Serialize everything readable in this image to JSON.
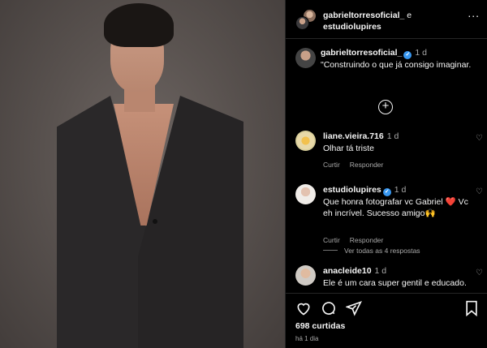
{
  "header": {
    "user1": "gabrieltorresoficial_",
    "connector": "e",
    "user2": "estudiolupires",
    "more_label": "..."
  },
  "caption": {
    "username": "gabrieltorresoficial_",
    "time": "1 d",
    "text": "\"Construindo o que já consigo imaginar."
  },
  "comments": [
    {
      "username": "liane.vieira.716",
      "time": "1 d",
      "text": "Olhar tá triste",
      "reply_label": "Responder",
      "like_label": "Curtir"
    },
    {
      "username": "estudiolupires",
      "time": "1 d",
      "text": "Que honra fotografar vc Gabriel ❤️ Vc eh incrível. Sucesso amigo🙌",
      "reply_label": "Responder",
      "like_label": "Curtir"
    },
    {
      "username": "anacleide10",
      "time": "1 d",
      "text": "Ele é um cara super gentil e educado."
    }
  ],
  "view_replies": "Ver todas as 4 respostas",
  "footer": {
    "likes": "698 curtidas",
    "time_ago": "há 1 dia"
  },
  "icons": [
    "heart-icon",
    "comment-icon",
    "share-icon",
    "save-icon",
    "plus-circle-icon"
  ],
  "colors": {
    "background": "#000000",
    "verified": "#3897f0",
    "muted": "#a8a8a8"
  }
}
